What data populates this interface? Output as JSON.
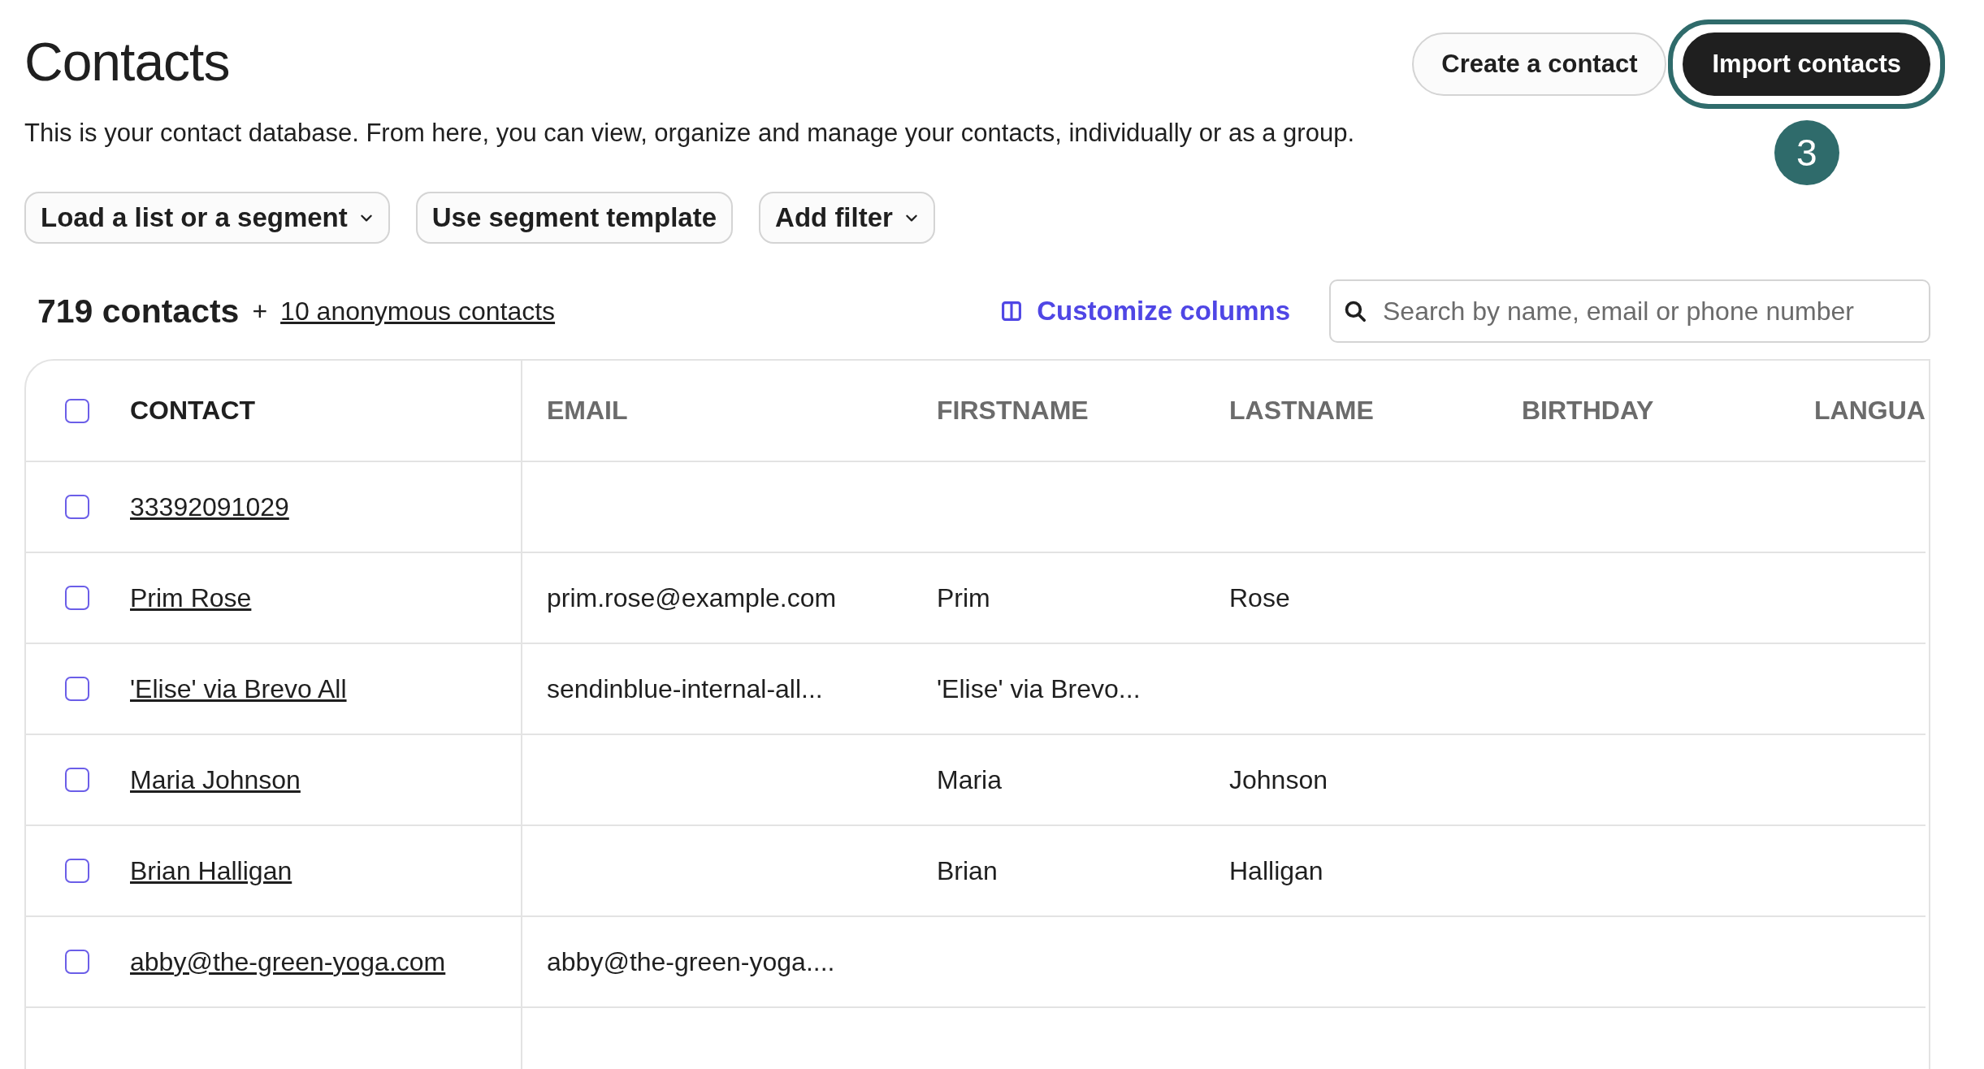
{
  "title": "Contacts",
  "header_buttons": [
    {
      "label": "Create a contact",
      "kind": "secondary",
      "highlighted": false
    },
    {
      "label": "Import contacts",
      "kind": "primary",
      "highlighted": true
    }
  ],
  "step_badge": "3",
  "description": "This is your contact database. From here, you can view, organize and manage your contacts, individually or as a group.",
  "filters": [
    {
      "label": "Load a list or a segment",
      "dropdown": true
    },
    {
      "label": "Use segment template",
      "dropdown": false
    },
    {
      "label": "Add filter",
      "dropdown": true
    }
  ],
  "summary": {
    "count": "719 contacts",
    "plus": "+",
    "anonymous_link": "10 anonymous contacts"
  },
  "customize_columns": "Customize columns",
  "search": {
    "placeholder": "Search by name, email or phone number"
  },
  "table": {
    "select_all_checked": false,
    "columns": [
      "CONTACT",
      "EMAIL",
      "FIRSTNAME",
      "LASTNAME",
      "BIRTHDAY",
      "LANGUA"
    ],
    "rows": [
      {
        "checked": false,
        "contact": "33392091029"
      },
      {
        "checked": false,
        "contact": "Prim Rose",
        "email": "prim.rose@example.com",
        "firstname": "Prim",
        "lastname": "Rose"
      },
      {
        "checked": false,
        "contact": "'Elise' via Brevo All",
        "email": "sendinblue-internal-all...",
        "firstname": "'Elise' via Brevo..."
      },
      {
        "checked": false,
        "contact": "Maria Johnson",
        "firstname": "Maria",
        "lastname": "Johnson"
      },
      {
        "checked": false,
        "contact": "Brian Halligan",
        "firstname": "Brian",
        "lastname": "Halligan"
      },
      {
        "checked": false,
        "contact": "abby@the-green-yoga.com",
        "email": "abby@the-green-yoga...."
      }
    ]
  }
}
